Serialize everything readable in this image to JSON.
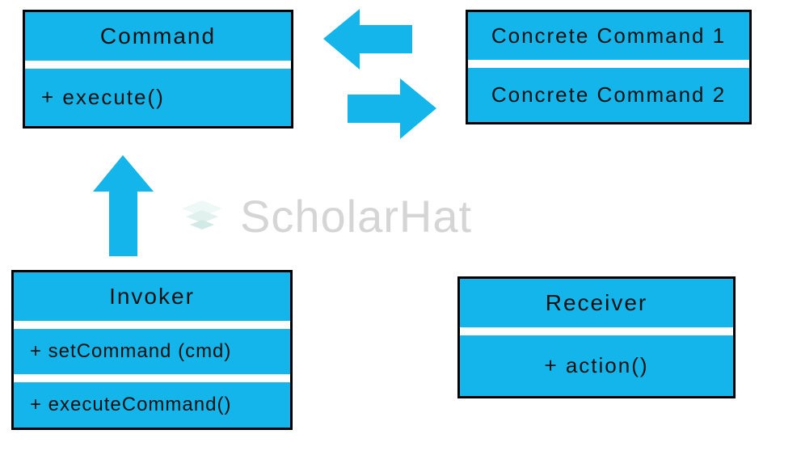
{
  "command_box": {
    "title": "Command",
    "method": "+ execute()"
  },
  "concrete_box": {
    "line1": "Concrete Command 1",
    "line2": "Concrete Command 2"
  },
  "invoker_box": {
    "title": "Invoker",
    "method1": "+ setCommand (cmd)",
    "method2": "+ executeCommand()"
  },
  "receiver_box": {
    "title": "Receiver",
    "method": "+ action()"
  },
  "watermark": {
    "text": "ScholarHat"
  },
  "colors": {
    "primary": "#13B5EA",
    "border": "#000000"
  }
}
